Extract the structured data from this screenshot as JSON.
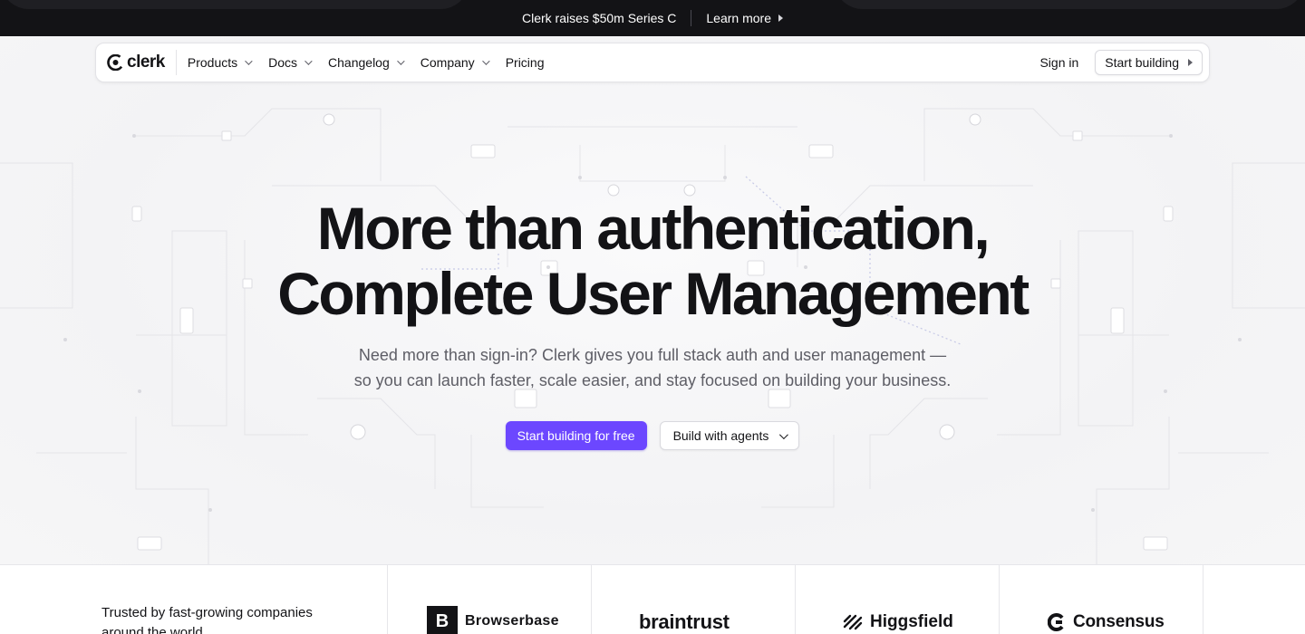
{
  "announcement": {
    "text": "Clerk raises $50m Series C",
    "link": "Learn more"
  },
  "nav": {
    "logo": "clerk",
    "items": [
      {
        "label": "Products",
        "dropdown": true
      },
      {
        "label": "Docs",
        "dropdown": true
      },
      {
        "label": "Changelog",
        "dropdown": true
      },
      {
        "label": "Company",
        "dropdown": true
      },
      {
        "label": "Pricing",
        "dropdown": false
      }
    ],
    "sign_in": "Sign in",
    "start_building": "Start building"
  },
  "hero": {
    "headline_line1": "More than authentication,",
    "headline_line2": "Complete User Management",
    "sub_line1": "Need more than sign-in? Clerk gives you full stack auth and user management —",
    "sub_line2": "so you can launch faster, scale easier, and stay focused on building your business.",
    "cta_primary": "Start building for free",
    "cta_secondary": "Build with agents"
  },
  "trusted": {
    "text": "Trusted by fast-growing companies around the world",
    "logos": [
      "Browserbase",
      "braintrust",
      "Higgsfield",
      "Consensus"
    ],
    "browserbase_mark": "B"
  },
  "colors": {
    "accent": "#6c47ff",
    "dark": "#131316",
    "muted": "#5e5e66"
  }
}
